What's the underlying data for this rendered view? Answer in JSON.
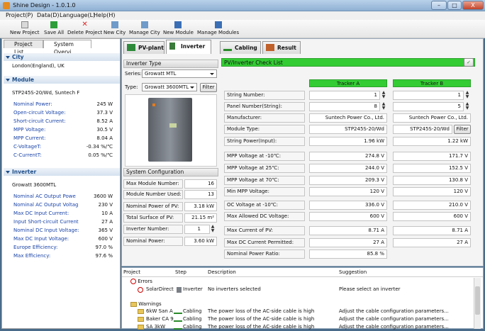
{
  "window": {
    "title": "Shine Design - 1.0.1.0",
    "min": "–",
    "max": "□",
    "close": "X"
  },
  "menu": [
    "Project(P)",
    "Data(D)",
    "Language(L)",
    "Help(H)"
  ],
  "toolbar": [
    "New Project",
    "Save All",
    "Delete Project",
    "New City",
    "Manage City",
    "New Module",
    "Manage Modules"
  ],
  "left": {
    "tabs": [
      "Project List",
      "System Overvi"
    ],
    "city_title": "City",
    "city": "London(England), UK",
    "module_title": "Module",
    "module_name": "STP245S-20/Wd, Suntech F",
    "module_rows": [
      [
        "Nominal Power:",
        "245 W"
      ],
      [
        "Open-circuit Voltage:",
        "37.3 V"
      ],
      [
        "Short-circuit Current:",
        "8.52 A"
      ],
      [
        "MPP Voltage:",
        "30.5 V"
      ],
      [
        "MPP Current:",
        "8.04 A"
      ],
      [
        "C-VoltageT:",
        "-0.34 %/℃"
      ],
      [
        "C-CurrentT:",
        "0.05 %/℃"
      ]
    ],
    "inverter_title": "Inverter",
    "inverter_name": "Growatt 3600MTL",
    "inverter_rows": [
      [
        "Nominal AC Output Powe",
        "3600 W"
      ],
      [
        "Nominal AC Output Voltag",
        "230 V"
      ],
      [
        "Max DC Input Current:",
        "10 A"
      ],
      [
        "Input Short-circuit Current",
        "27 A"
      ],
      [
        "Nominal DC Input Voltage:",
        "365 V"
      ],
      [
        "Max DC Input Voltage:",
        "600 V"
      ],
      [
        "Europe Efficiency:",
        "97.0 %"
      ],
      [
        "Max Efficiency:",
        "97.6 %"
      ]
    ]
  },
  "tabs": [
    "PV-plant",
    "Inverter",
    "Cabling",
    "Result"
  ],
  "inverter_type": {
    "title": "Inverter Type",
    "series_label": "Series:",
    "series": "Growatt MTL",
    "type_label": "Type:",
    "type": "Growatt 3600MTL",
    "filter": "Filter"
  },
  "sysconf": {
    "title": "System Configuration",
    "rows": [
      [
        "Max Module Number:",
        "16"
      ],
      [
        "Module Number Used:",
        "13"
      ],
      [
        "Nominal Power of PV:",
        "3.18 kW"
      ],
      [
        "Total Surface of PV:",
        "21.15 m²"
      ],
      [
        "Inverter Number:",
        "1"
      ],
      [
        "Nominal Power:",
        "3.60 kW"
      ]
    ]
  },
  "check": {
    "title": "PV/Inverter Check List",
    "tracker_a": "Tracker A",
    "tracker_b": "Tracker B",
    "filter": "Filter",
    "rows": [
      [
        "String Number:",
        "1",
        "1"
      ],
      [
        "Panel Number(String):",
        "8",
        "5"
      ],
      [
        "Manufacturer:",
        "Suntech Power Co., Ltd.",
        "Suntech Power Co., Ltd."
      ],
      [
        "Module Type:",
        "STP245S-20/Wd",
        "STP245S-20/Wd"
      ],
      [
        "String Power(Input):",
        "1.96 kW",
        "1.22 kW"
      ],
      [
        "MPP Voltage at -10℃:",
        "274.8 V",
        "171.7 V"
      ],
      [
        "MPP Voltage at 25℃:",
        "244.0 V",
        "152.5 V"
      ],
      [
        "MPP Voltage at 70℃:",
        "209.3 V",
        "130.8 V"
      ],
      [
        "Min MPP Voltage:",
        "120 V",
        "120 V"
      ],
      [
        "OC Voltage at -10℃:",
        "336.0 V",
        "210.0 V"
      ],
      [
        "Max Allowed DC Voltage:",
        "600 V",
        "600 V"
      ],
      [
        "Max Current of PV:",
        "8.71 A",
        "8.71 A"
      ],
      [
        "Max DC Current Permitted:",
        "27 A",
        "27 A"
      ],
      [
        "Nominal Power Ratio:",
        "85.8 %",
        ""
      ]
    ]
  },
  "issues": {
    "headers": [
      "Project",
      "Step",
      "Description",
      "Suggestion"
    ],
    "errors_label": "Errors",
    "warnings_label": "Warnings",
    "rows": [
      [
        "SolarDirect",
        "Inverter",
        "No inverters selected",
        "Please select an inverter"
      ],
      [
        "6kW San A",
        "Cabling",
        "The power loss of the AC-side cable is high",
        "Adjust the cable configuration parameters..."
      ],
      [
        "Baker CA 9",
        "Cabling",
        "The power loss of the AC-side cable is high",
        "Adjust the cable configuration parameters..."
      ],
      [
        "SA 3kW",
        "Cabling",
        "The power loss of the AC-side cable is high",
        "Adjust the cable configuration parameters..."
      ]
    ]
  },
  "colors": {
    "tracker": "#33cc33",
    "checklist_bar": "#33cc33",
    "link_blue": "#1a44a8"
  }
}
